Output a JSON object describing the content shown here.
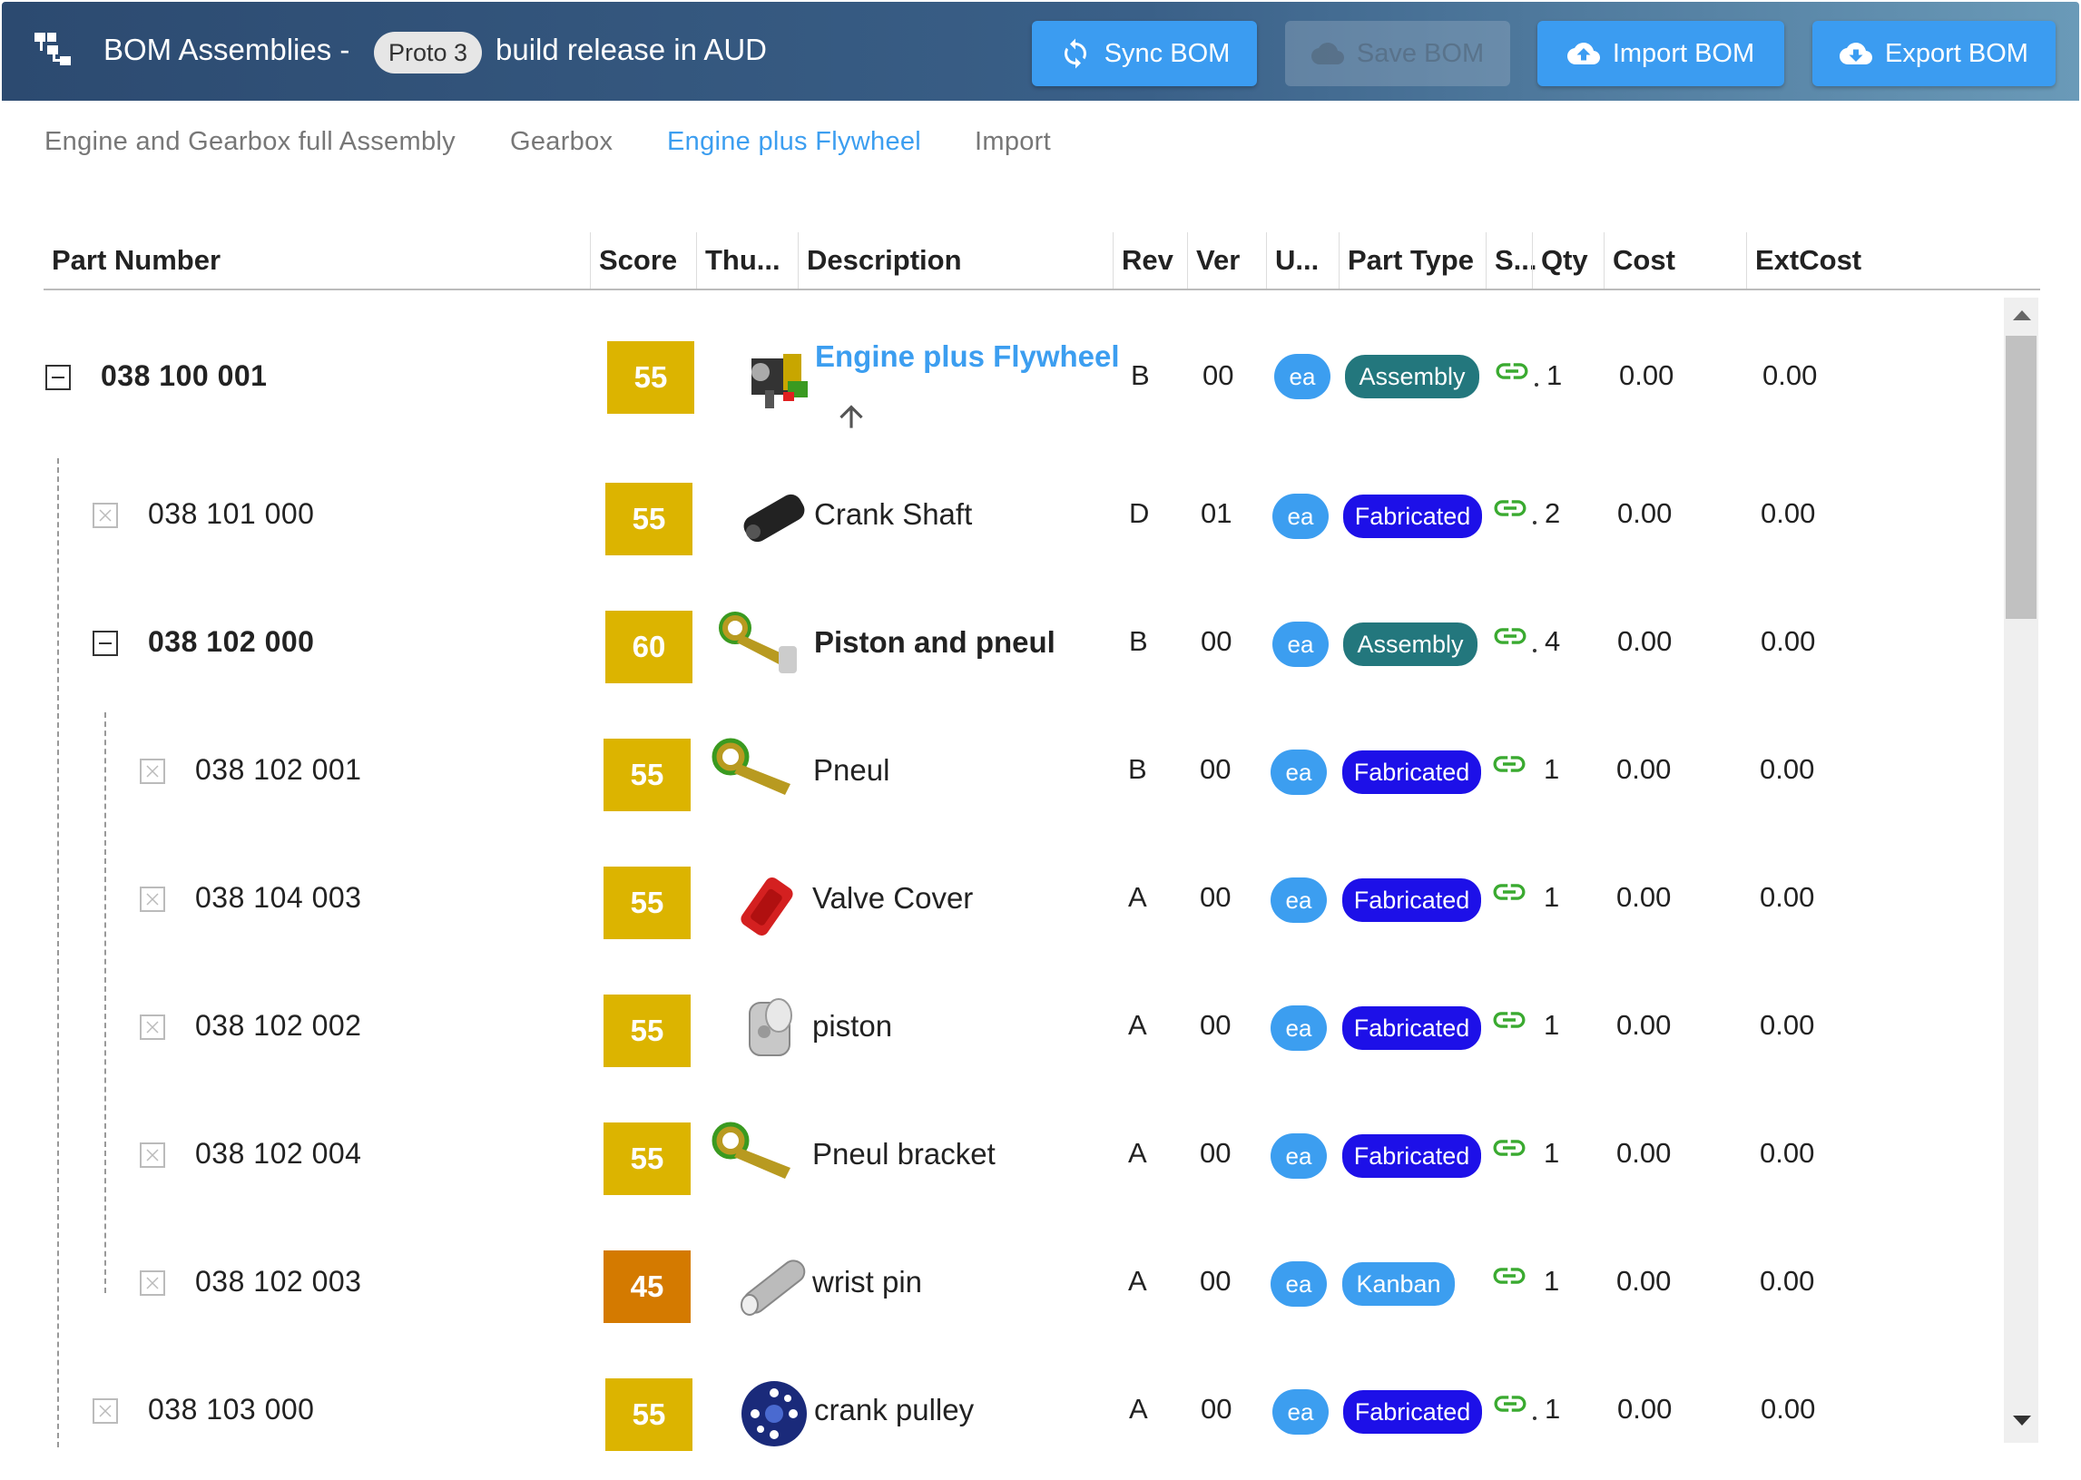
{
  "header": {
    "title": "BOM Assemblies -",
    "proto_chip": "Proto 3",
    "subtitle": "build release in AUD",
    "buttons": {
      "sync": "Sync BOM",
      "save": "Save BOM",
      "import": "Import BOM",
      "export": "Export BOM"
    },
    "accent_color": "#3b9cf1"
  },
  "tabs": [
    {
      "label": "Engine and Gearbox full Assembly",
      "active": false
    },
    {
      "label": "Gearbox",
      "active": false
    },
    {
      "label": "Engine plus Flywheel",
      "active": true
    },
    {
      "label": "Import",
      "active": false
    }
  ],
  "columns": {
    "part_number": "Part Number",
    "score": "Score",
    "thumbnail": "Thu...",
    "description": "Description",
    "rev": "Rev",
    "ver": "Ver",
    "uom": "U...",
    "part_type": "Part Type",
    "status": "S...",
    "qty": "Qty",
    "cost": "Cost",
    "ext_cost": "ExtCost"
  },
  "rows": [
    {
      "part_number": "038 100 001",
      "score": "55",
      "description": "Engine plus Flywheel",
      "rev": "B",
      "ver": "00",
      "uom": "ea",
      "part_type": "Assembly",
      "qty": "1",
      "cost": "0.00",
      "ext_cost": "0.00",
      "thumbnail_icon": "engine-assembly-icon"
    },
    {
      "part_number": "038 101 000",
      "score": "55",
      "description": "Crank Shaft",
      "rev": "D",
      "ver": "01",
      "uom": "ea",
      "part_type": "Fabricated",
      "qty": "2",
      "cost": "0.00",
      "ext_cost": "0.00",
      "thumbnail_icon": "crank-shaft-icon"
    },
    {
      "part_number": "038 102 000",
      "score": "60",
      "description": "Piston and pneul",
      "rev": "B",
      "ver": "00",
      "uom": "ea",
      "part_type": "Assembly",
      "qty": "4",
      "cost": "0.00",
      "ext_cost": "0.00",
      "thumbnail_icon": "piston-rod-icon"
    },
    {
      "part_number": "038 102 001",
      "score": "55",
      "description": "Pneul",
      "rev": "B",
      "ver": "00",
      "uom": "ea",
      "part_type": "Fabricated",
      "qty": "1",
      "cost": "0.00",
      "ext_cost": "0.00",
      "thumbnail_icon": "conrod-icon"
    },
    {
      "part_number": "038 104 003",
      "score": "55",
      "description": "Valve Cover",
      "rev": "A",
      "ver": "00",
      "uom": "ea",
      "part_type": "Fabricated",
      "qty": "1",
      "cost": "0.00",
      "ext_cost": "0.00",
      "thumbnail_icon": "valve-cover-icon"
    },
    {
      "part_number": "038 102 002",
      "score": "55",
      "description": "piston",
      "rev": "A",
      "ver": "00",
      "uom": "ea",
      "part_type": "Fabricated",
      "qty": "1",
      "cost": "0.00",
      "ext_cost": "0.00",
      "thumbnail_icon": "piston-icon"
    },
    {
      "part_number": "038 102 004",
      "score": "55",
      "description": "Pneul bracket",
      "rev": "A",
      "ver": "00",
      "uom": "ea",
      "part_type": "Fabricated",
      "qty": "1",
      "cost": "0.00",
      "ext_cost": "0.00",
      "thumbnail_icon": "conrod-icon"
    },
    {
      "part_number": "038 102 003",
      "score": "45",
      "description": "wrist pin",
      "rev": "A",
      "ver": "00",
      "uom": "ea",
      "part_type": "Kanban",
      "qty": "1",
      "cost": "0.00",
      "ext_cost": "0.00",
      "thumbnail_icon": "wrist-pin-icon"
    },
    {
      "part_number": "038 103 000",
      "score": "55",
      "description": "crank pulley",
      "rev": "A",
      "ver": "00",
      "uom": "ea",
      "part_type": "Fabricated",
      "qty": "1",
      "cost": "0.00",
      "ext_cost": "0.00",
      "thumbnail_icon": "pulley-icon"
    }
  ]
}
